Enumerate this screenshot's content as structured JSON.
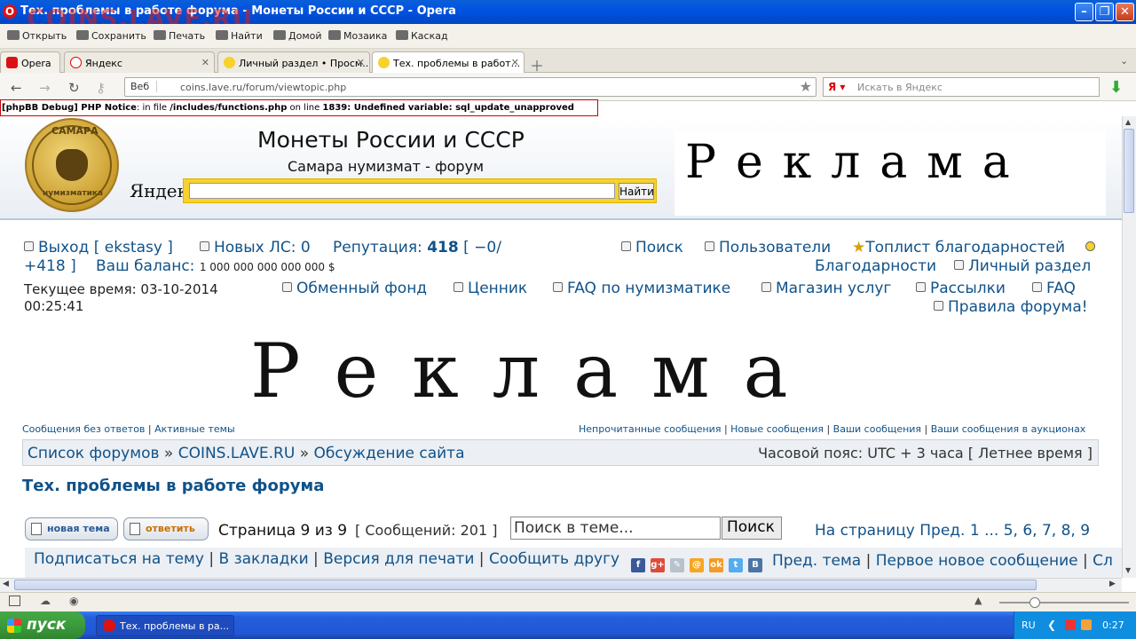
{
  "window": {
    "title": "Тех. проблемы в работе форума - Монеты России и СССР - Opera",
    "watermark": "COINS.LAVE.RU"
  },
  "toolbar": {
    "items": [
      "Открыть",
      "Сохранить",
      "Печать",
      "Найти",
      "Домой",
      "Мозаика",
      "Каскад"
    ]
  },
  "tabs": {
    "opera": "Opera",
    "items": [
      "Яндекс",
      "Личный раздел • Просм...",
      "Тех. проблемы в работ..."
    ]
  },
  "address": {
    "web_label": "Веб",
    "url": "coins.lave.ru/forum/viewtopic.php",
    "search_placeholder": "Искать в Яндекс"
  },
  "debug": {
    "prefix": "[phpBB Debug] PHP Notice",
    "mid1": ": in file ",
    "file": "/includes/functions.php",
    "mid2": " on line ",
    "line": "1839",
    "msg": ": Undefined variable: sql_update_unapproved"
  },
  "header": {
    "title": "Монеты России и СССР",
    "subtitle": "Самара нумизмат - форум",
    "logo_top": "САМАРА",
    "logo_bottom": "нумизматика",
    "yandex": "Яндекс",
    "search_button": "Найти",
    "ad_text": "Реклама"
  },
  "nav": {
    "logout": "Выход [ ekstasy ]",
    "new_pm": "Новых ЛС: 0",
    "rep_label": "Репутация: ",
    "rep_value": "418",
    "rep_tail": " [ −0/",
    "rep_line2": "+418 ]",
    "balance_label": "Ваш баланс:",
    "balance_value": "1 000 000 000 000 000 $",
    "time": "Текущее время: 03-10-2014",
    "time2": "00:25:41",
    "search": "Поиск",
    "users": "Пользователи",
    "toplist": "Топлист благодарностей",
    "thanks": "Благодарности",
    "personal": "Личный раздел",
    "exchange": "Обменный фонд",
    "pricelist": "Ценник",
    "faq_num": "FAQ по нумизматике",
    "shop": "Магазин услуг",
    "mailing": "Рассылки",
    "faq": "FAQ",
    "rules": "Правила форума!"
  },
  "banner": {
    "text": "Реклама"
  },
  "links": {
    "left": [
      "Сообщения без ответов",
      "Активные темы"
    ],
    "right": [
      "Непрочитанные сообщения",
      "Новые сообщения",
      "Ваши сообщения",
      "Ваши сообщения в аукционах"
    ]
  },
  "breadcrumb": {
    "items": [
      "Список форумов",
      "COINS.LAVE.RU",
      "Обсуждение сайта"
    ],
    "sep": " » ",
    "timezone": "Часовой пояс: UTC + 3 часа [ Летнее время ]"
  },
  "topic": {
    "title": "Тех. проблемы в работе форума"
  },
  "pagination": {
    "new_topic": "новая тема",
    "reply": "ответить",
    "page_info": "Страница 9 из 9",
    "post_count": "[ Сообщений: 201 ]",
    "search_placeholder": "Поиск в теме...",
    "search_button": "Поиск",
    "goto": "На страницу Пред.",
    "pages": "1 ... 5, 6, 7, 8, 9"
  },
  "bottom": {
    "left": [
      "Подписаться на тему",
      "В закладки",
      "Версия для печати",
      "Сообщить другу"
    ],
    "right": [
      "Пред. тема",
      "Первое новое сообщение",
      "Сл"
    ],
    "social": [
      "f",
      "g+",
      "✎",
      "@",
      "ok",
      "t",
      "B"
    ]
  },
  "taskbar": {
    "start": "пуск",
    "item": "Тех. проблемы в ра...",
    "lang": "RU",
    "clock": "0:27"
  },
  "colors": {
    "link": "#105289",
    "xp_blue": "#0054e3",
    "start_green": "#3c9b3c"
  }
}
